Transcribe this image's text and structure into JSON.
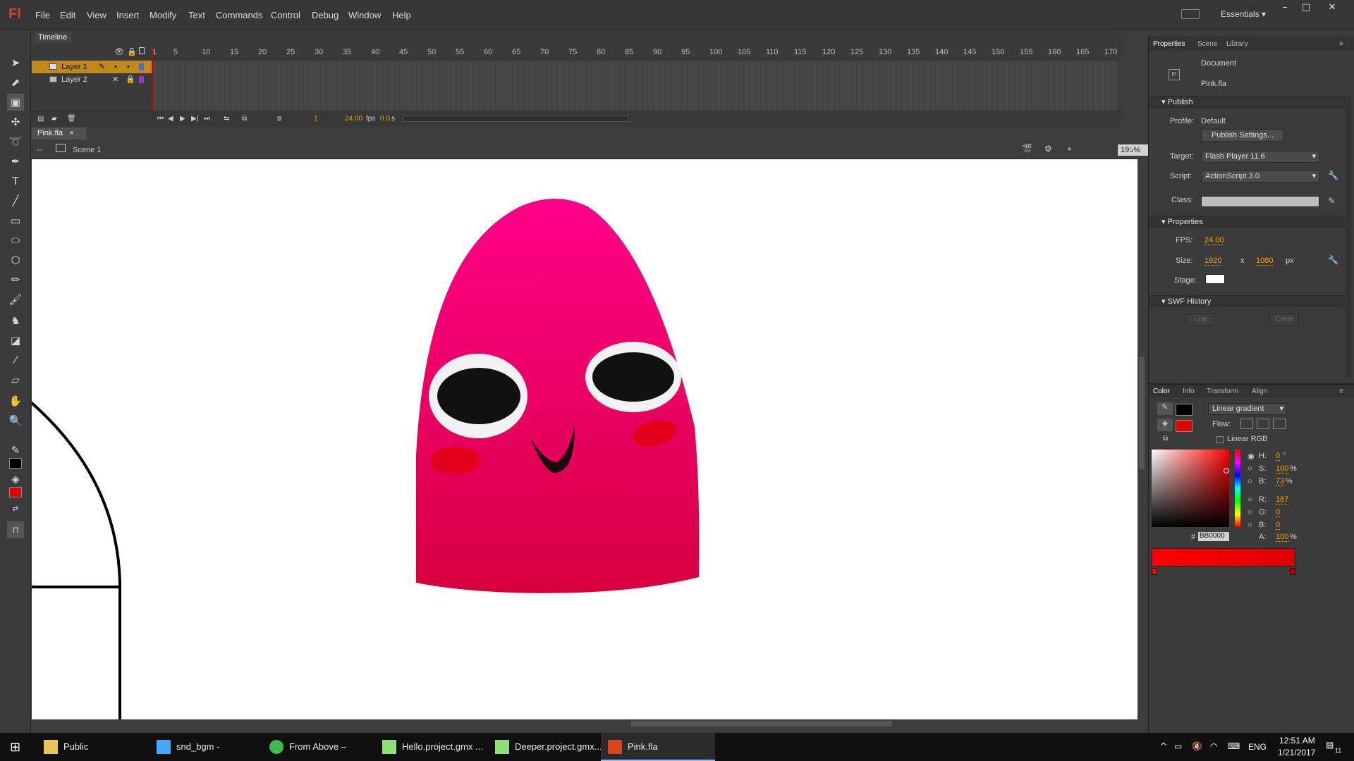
{
  "menubar": {
    "logo": "Fl",
    "items": [
      "File",
      "Edit",
      "View",
      "Insert",
      "Modify",
      "Text",
      "Commands",
      "Control",
      "Debug",
      "Window",
      "Help"
    ],
    "workspace": "Essentials"
  },
  "timeline": {
    "tab": "Timeline",
    "frame_numbers": [
      "1",
      "5",
      "10",
      "15",
      "20",
      "25",
      "30",
      "35",
      "40",
      "45",
      "50",
      "55",
      "60",
      "65",
      "70",
      "75",
      "80",
      "85",
      "90",
      "95",
      "100",
      "105",
      "110",
      "115",
      "120",
      "125",
      "130",
      "135",
      "140",
      "145",
      "150",
      "155",
      "160",
      "165",
      "170"
    ],
    "layers": [
      {
        "name": "Layer 1",
        "color": "#3d6fd9"
      },
      {
        "name": "Layer 2",
        "color": "#9b2fd1"
      }
    ],
    "current_frame": "1",
    "fps": "24.00",
    "fps_unit": "fps",
    "time": "0.0",
    "time_unit": "s"
  },
  "document": {
    "tab": "Pink.fla",
    "scene": "Scene 1",
    "zoom": "195%"
  },
  "properties_panel": {
    "tabs": [
      "Properties",
      "Scene",
      "Library"
    ],
    "doc_type": "Document",
    "doc_name": "Pink.fla",
    "publish": {
      "header": "Publish",
      "profile_label": "Profile:",
      "profile_value": "Default",
      "publish_settings": "Publish Settings...",
      "target_label": "Target:",
      "target_value": "Flash Player 11.6",
      "script_label": "Script:",
      "script_value": "ActionScript 3.0",
      "class_label": "Class:"
    },
    "properties": {
      "header": "Properties",
      "fps_label": "FPS:",
      "fps_value": "24.00",
      "size_label": "Size:",
      "width": "1920",
      "x": "x",
      "height": "1080",
      "unit": "px",
      "stage_label": "Stage:",
      "stage_color": "#ffffff"
    },
    "swf_history": {
      "header": "SWF History",
      "log": "Log",
      "clear": "Clear"
    }
  },
  "color_panel": {
    "tabs": [
      "Color",
      "Info",
      "Transform",
      "Align"
    ],
    "fill_type": "Linear gradient",
    "flow_label": "Flow:",
    "linear_rgb": "Linear RGB",
    "stroke_color": "#000000",
    "fill_color": "#dd0000",
    "h": {
      "label": "H:",
      "value": "0",
      "unit": "°"
    },
    "s": {
      "label": "S:",
      "value": "100",
      "unit": "%"
    },
    "b": {
      "label": "B:",
      "value": "73",
      "unit": "%"
    },
    "r": {
      "label": "R:",
      "value": "187"
    },
    "g": {
      "label": "G:",
      "value": "0"
    },
    "bl": {
      "label": "B:",
      "value": "0"
    },
    "hex_label": "#",
    "hex": "BB0000",
    "a": {
      "label": "A:",
      "value": "100",
      "unit": "%"
    }
  },
  "taskbar": {
    "items": [
      {
        "label": "Public",
        "color": "#e8c35a"
      },
      {
        "label": "snd_bgm - Resulta...",
        "color": "#4aa3ff"
      },
      {
        "label": "From Above – Rodr...",
        "color": "#3cba54"
      },
      {
        "label": "Hello.project.gmx ...",
        "color": "#8ee07a"
      },
      {
        "label": "Deeper.project.gmx...",
        "color": "#8ee07a"
      },
      {
        "label": "Pink.fla",
        "color": "#d8451f"
      }
    ],
    "lang": "ENG",
    "time": "12:51 AM",
    "date": "1/21/2017",
    "notification_count": "11"
  }
}
